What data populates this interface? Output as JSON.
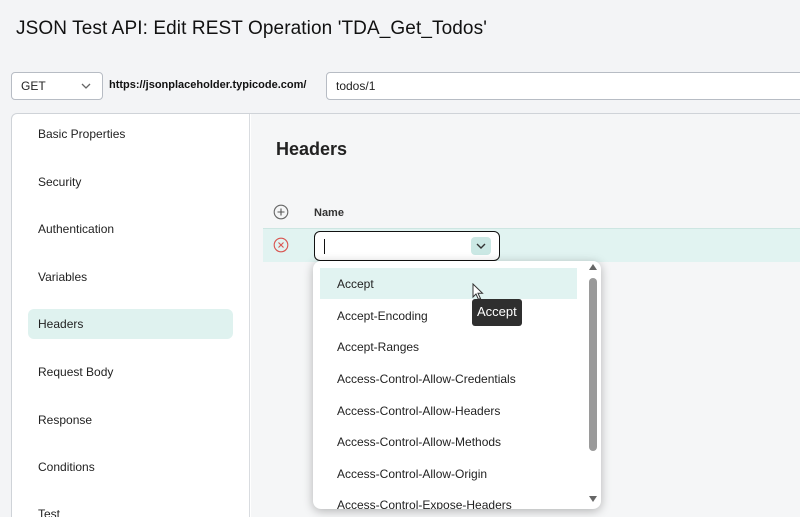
{
  "window": {
    "title": "JSON Test API: Edit REST Operation 'TDA_Get_Todos'"
  },
  "request": {
    "method": "GET",
    "base_url": "https://jsonplaceholder.typicode.com/",
    "path": "todos/1"
  },
  "sidebar": {
    "items": [
      {
        "label": "Basic Properties",
        "active": false
      },
      {
        "label": "Security",
        "active": false
      },
      {
        "label": "Authentication",
        "active": false
      },
      {
        "label": "Variables",
        "active": false
      },
      {
        "label": "Headers",
        "active": true
      },
      {
        "label": "Request Body",
        "active": false
      },
      {
        "label": "Response",
        "active": false
      },
      {
        "label": "Conditions",
        "active": false
      },
      {
        "label": "Test",
        "active": false
      }
    ]
  },
  "main": {
    "section_title": "Headers",
    "columns": {
      "name": "Name"
    },
    "row": {
      "name_value": ""
    }
  },
  "dropdown": {
    "options": [
      "Accept",
      "Accept-Encoding",
      "Accept-Ranges",
      "Access-Control-Allow-Credentials",
      "Access-Control-Allow-Headers",
      "Access-Control-Allow-Methods",
      "Access-Control-Allow-Origin",
      "Access-Control-Expose-Headers"
    ],
    "hovered_option": "Accept"
  },
  "tooltip": {
    "text": "Accept"
  },
  "icons": {
    "add": "plus-circle-icon",
    "remove": "x-circle-icon",
    "dropdown": "chevron-down-icon"
  },
  "colors": {
    "accent_light": "#dff2ef",
    "remove_red": "#d9534f"
  }
}
